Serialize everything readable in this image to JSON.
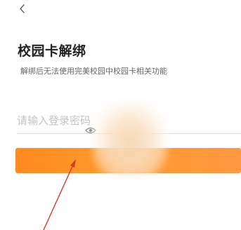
{
  "header": {
    "back_icon": "chevron-left-icon"
  },
  "page": {
    "title": "校园卡解绑",
    "description": "解绑后无法使用完美校园中校园卡相关功能"
  },
  "form": {
    "password_placeholder": "请输入登录密码",
    "password_value": "",
    "visibility_icon": "eye-icon",
    "submit_label": ""
  },
  "colors": {
    "accent": "#ff9a2e",
    "annotation_arrow": "#d63b2c"
  }
}
